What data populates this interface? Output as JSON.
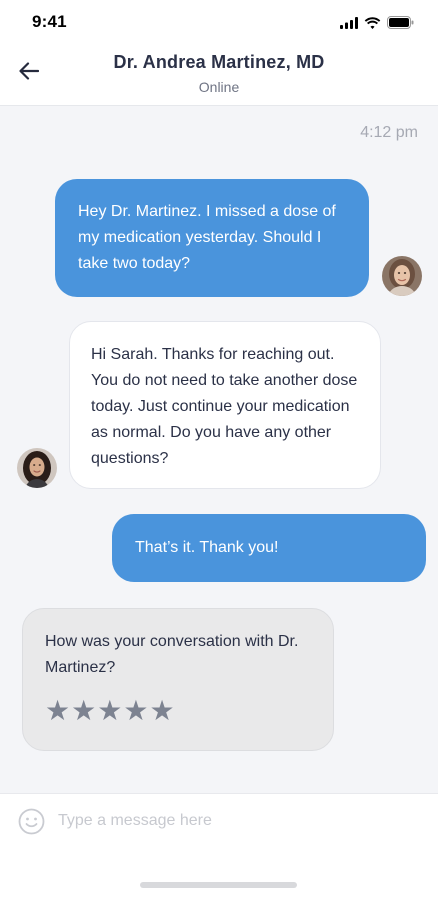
{
  "status_bar": {
    "time": "9:41",
    "icons": [
      "signal-icon",
      "wifi-icon",
      "battery-icon"
    ]
  },
  "header": {
    "title": "Dr. Andrea Martinez, MD",
    "status": "Online",
    "back_icon": "arrow-left-icon"
  },
  "chat": {
    "timestamp": "4:12 pm",
    "messages": [
      {
        "sender": "user",
        "text": "Hey Dr. Martinez. I missed a dose of my medication yesterday. Should I take two today?"
      },
      {
        "sender": "doctor",
        "text": "Hi Sarah. Thanks for reaching out. You do not need to take another dose today. Just continue your medication as normal. Do you have any other questions?"
      },
      {
        "sender": "user",
        "text": "That’s it. Thank you!"
      }
    ],
    "rating": {
      "question": "How was your conversation with Dr. Martinez?",
      "stars": [
        "★",
        "★",
        "★",
        "★",
        "★"
      ],
      "selected": 0,
      "max": 5
    }
  },
  "composer": {
    "placeholder": "Type a message here",
    "value": "",
    "emoji_icon": "smiley-icon"
  },
  "colors": {
    "outgoing_bubble": "#4a94dc",
    "incoming_bubble": "#ffffff",
    "chat_background": "#f4f5f8",
    "rating_card": "#e9e9ea",
    "star": "#7d8391"
  }
}
